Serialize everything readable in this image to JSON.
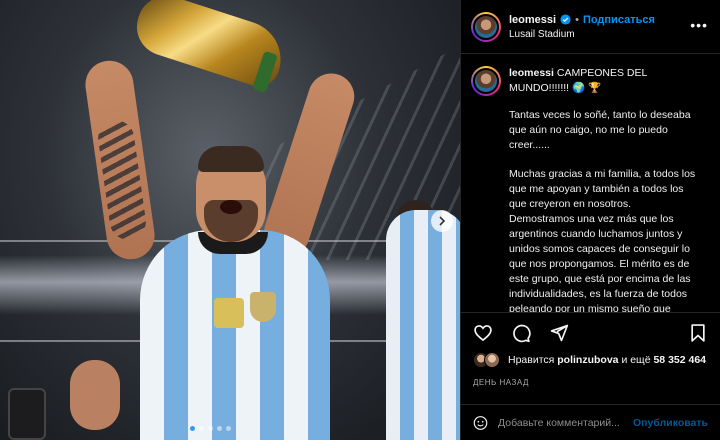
{
  "colors": {
    "accent": "#0095f6",
    "background": "#000000",
    "text": "#f5f5f5",
    "muted": "#a8a8a8",
    "border": "#262626"
  },
  "post": {
    "author": "leomessi",
    "follow_label": "Подписаться",
    "separator": "•",
    "location": "Lusail Stadium",
    "more_icon": "more-horizontal-icon",
    "carousel_next_icon": "chevron-right-icon",
    "carousel": {
      "current_slide": 1,
      "total_slides": 5
    }
  },
  "caption": {
    "author": "leomessi",
    "title": "CAMPEONES DEL MUNDO!!!!!!! 🌍 🏆",
    "paragraph_1": "Tantas veces lo soñé, tanto lo deseaba que aún no caigo, no me lo puedo creer......",
    "paragraph_2": "Muchas gracias a mi familia, a todos los que me apoyan y también a todos los que creyeron en nosotros. Demostramos una vez más que los argentinos cuando luchamos juntos y unidos somos capaces de conseguir lo que nos propongamos. El mérito es de este grupo, que está por encima de las individualidades, es la fuerza de todos peleando por un mismo sueño que también era el de todos los"
  },
  "actions": {
    "like_icon": "heart-icon",
    "comment_icon": "comment-icon",
    "share_icon": "share-icon",
    "save_icon": "bookmark-icon"
  },
  "likes": {
    "prefix": "Нравится",
    "user": "polinzubova",
    "middle": "и ещё",
    "count": "58 352 464"
  },
  "time": "ДЕНЬ НАЗАД",
  "comment": {
    "emoji_icon": "emoji-icon",
    "placeholder": "Добавьте комментарий...",
    "publish_label": "Опубликовать"
  }
}
